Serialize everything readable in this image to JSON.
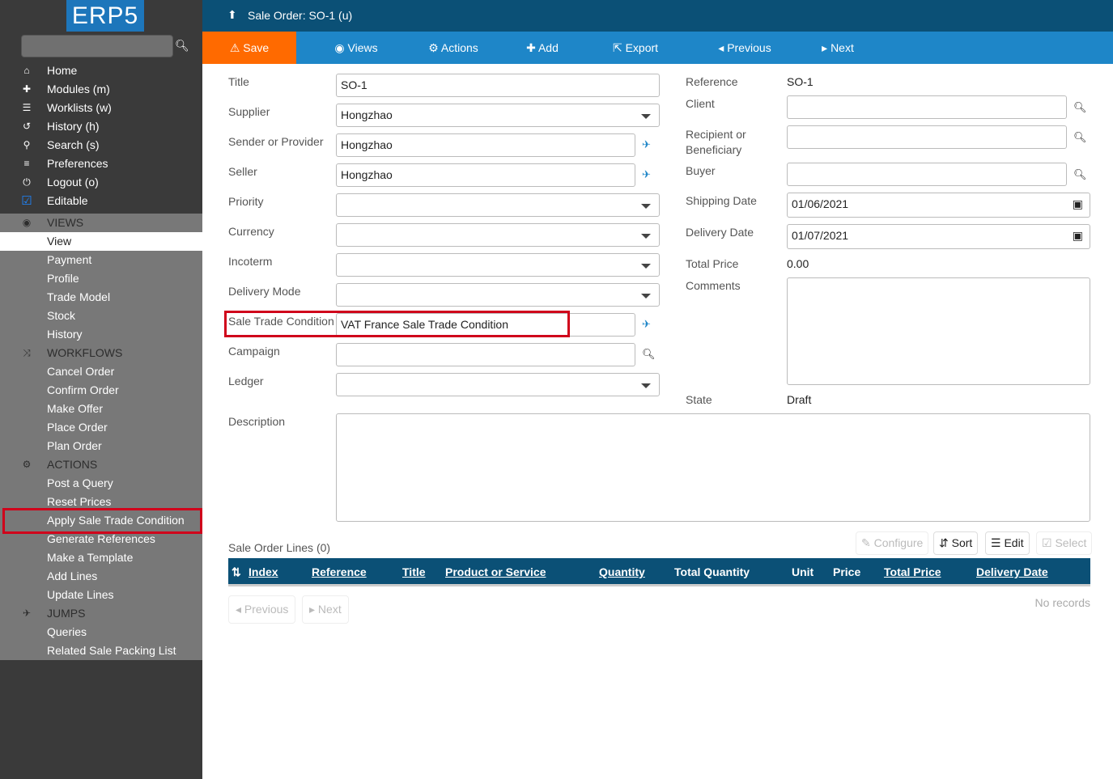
{
  "logo": "ERP5",
  "sidebar": {
    "items": [
      {
        "icon": "home-icon",
        "glyph": "⌂",
        "label": "Home"
      },
      {
        "icon": "puzzle-icon",
        "glyph": "✚",
        "label": "Modules (m)"
      },
      {
        "icon": "worklist-icon",
        "glyph": "☰",
        "label": "Worklists (w)"
      },
      {
        "icon": "history-icon",
        "glyph": "↺",
        "label": "History (h)"
      },
      {
        "icon": "search-icon",
        "glyph": "⚲",
        "label": "Search (s)"
      },
      {
        "icon": "sliders-icon",
        "glyph": "≡",
        "label": "Preferences"
      },
      {
        "icon": "power-icon",
        "glyph": "⏻",
        "label": "Logout (o)"
      },
      {
        "icon": "checkbox-icon",
        "glyph": "☑",
        "label": "Editable"
      }
    ],
    "sections": [
      {
        "header": "VIEWS",
        "icon": "eye-icon",
        "glyph": "◉",
        "items": [
          "View",
          "Payment",
          "Profile",
          "Trade Model",
          "Stock",
          "History"
        ],
        "active": "View"
      },
      {
        "header": "WORKFLOWS",
        "icon": "shuffle-icon",
        "glyph": "⤨",
        "items": [
          "Cancel Order",
          "Confirm Order",
          "Make Offer",
          "Place Order",
          "Plan Order"
        ]
      },
      {
        "header": "ACTIONS",
        "icon": "gears-icon",
        "glyph": "⚙",
        "items": [
          "Post a Query",
          "Reset Prices",
          "Apply Sale Trade Condition",
          "Generate References",
          "Make a Template",
          "Add Lines",
          "Update Lines"
        ]
      },
      {
        "header": "JUMPS",
        "icon": "plane-icon",
        "glyph": "✈",
        "items": [
          "Queries",
          "Related Sale Packing List"
        ]
      }
    ]
  },
  "header": {
    "title": "Sale Order: SO-1 (u)"
  },
  "toolbar": {
    "save": "Save",
    "views": "Views",
    "actions": "Actions",
    "add": "Add",
    "export": "Export",
    "previous": "Previous",
    "next": "Next"
  },
  "form": {
    "left": [
      {
        "label": "Title",
        "value": "SO-1",
        "type": "text"
      },
      {
        "label": "Supplier",
        "value": "Hongzhao",
        "type": "select"
      },
      {
        "label": "Sender or Provider",
        "value": "Hongzhao",
        "type": "relation"
      },
      {
        "label": "Seller",
        "value": "Hongzhao",
        "type": "relation"
      },
      {
        "label": "Priority",
        "value": "",
        "type": "select"
      },
      {
        "label": "Currency",
        "value": "",
        "type": "select"
      },
      {
        "label": "Incoterm",
        "value": "",
        "type": "select"
      },
      {
        "label": "Delivery Mode",
        "value": "",
        "type": "select"
      },
      {
        "label": "Sale Trade Condition",
        "value": "VAT France Sale Trade Condition",
        "type": "relation"
      },
      {
        "label": "Campaign",
        "value": "",
        "type": "search"
      },
      {
        "label": "Ledger",
        "value": "",
        "type": "select"
      }
    ],
    "right": {
      "reference_label": "Reference",
      "reference": "SO-1",
      "client_label": "Client",
      "client": "",
      "recipient_label": "Recipient or Beneficiary",
      "recipient": "",
      "buyer_label": "Buyer",
      "buyer": "",
      "shipping_date_label": "Shipping Date",
      "shipping_date": "01/06/2021",
      "delivery_date_label": "Delivery Date",
      "delivery_date": "01/07/2021",
      "total_price_label": "Total Price",
      "total_price": "0.00",
      "comments_label": "Comments",
      "state_label": "State",
      "state": "Draft"
    },
    "description_label": "Description"
  },
  "lines": {
    "title": "Sale Order Lines (0)",
    "buttons": {
      "configure": "Configure",
      "sort": "Sort",
      "edit": "Edit",
      "select": "Select"
    },
    "columns": [
      "Index",
      "Reference",
      "Title",
      "Product or Service",
      "Quantity",
      "Total Quantity",
      "Unit",
      "Price",
      "Total Price",
      "Delivery Date"
    ],
    "empty": "No records",
    "previous": "Previous",
    "next": "Next"
  },
  "colors": {
    "topbar": "#0b5076",
    "navbar": "#1e86c8",
    "save": "#ff6a00",
    "highlight": "#d0021b"
  }
}
